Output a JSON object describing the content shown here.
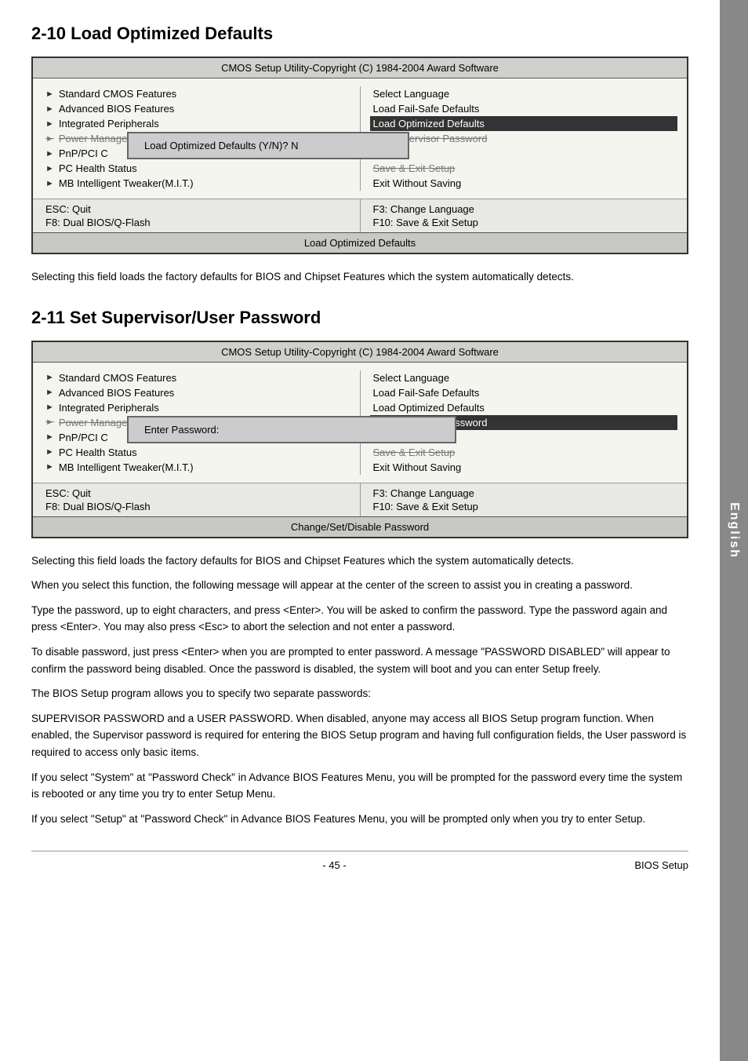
{
  "side_tab": "English",
  "section1": {
    "heading": "2-10    Load Optimized Defaults",
    "bios": {
      "title": "CMOS Setup Utility-Copyright (C) 1984-2004 Award Software",
      "left_items": [
        {
          "arrow": true,
          "label": "Standard CMOS Features",
          "highlighted": false
        },
        {
          "arrow": true,
          "label": "Advanced BIOS Features",
          "highlighted": false
        },
        {
          "arrow": true,
          "label": "Integrated Peripherals",
          "highlighted": false
        },
        {
          "arrow": true,
          "label": "Power Management Setup",
          "highlighted": false,
          "strikethrough": true
        },
        {
          "arrow": true,
          "label": "PnP/PCI C",
          "highlighted": false,
          "dialog": true
        },
        {
          "arrow": true,
          "label": "PC Health Status",
          "highlighted": false,
          "strikethrough": false
        },
        {
          "arrow": true,
          "label": "MB Intelligent Tweaker(M.I.T.)",
          "highlighted": false
        }
      ],
      "right_items": [
        {
          "label": "Select Language",
          "highlighted": false
        },
        {
          "label": "Load Fail-Safe Defaults",
          "highlighted": false
        },
        {
          "label": "Load Optimized Defaults",
          "highlighted": true
        },
        {
          "label": "Set Supervisor Password",
          "highlighted": false,
          "strikethrough": true
        },
        {
          "label": "",
          "highlighted": false
        },
        {
          "label": "Save & Exit Setup",
          "highlighted": false,
          "strikethrough": true
        },
        {
          "label": "Exit Without Saving",
          "highlighted": false
        }
      ],
      "dialog1_text": "Load Optimized Defaults (Y/N)? N",
      "footer": {
        "left": [
          "ESC: Quit",
          "F8: Dual BIOS/Q-Flash"
        ],
        "right": [
          "F3: Change Language",
          "F10: Save & Exit Setup"
        ]
      },
      "status_bar": "Load Optimized Defaults"
    },
    "body_text": "Selecting this field loads the factory defaults for BIOS and Chipset Features which the system automatically detects."
  },
  "section2": {
    "heading": "2-11    Set Supervisor/User Password",
    "bios": {
      "title": "CMOS Setup Utility-Copyright (C) 1984-2004 Award Software",
      "left_items": [
        {
          "arrow": true,
          "label": "Standard CMOS Features",
          "highlighted": false
        },
        {
          "arrow": true,
          "label": "Advanced BIOS Features",
          "highlighted": false
        },
        {
          "arrow": true,
          "label": "Integrated Peripherals",
          "highlighted": false
        },
        {
          "arrow": true,
          "label": "Power Management Setup",
          "highlighted": false,
          "strikethrough": true
        },
        {
          "arrow": true,
          "label": "PnP/PCI C",
          "highlighted": false,
          "dialog": true
        },
        {
          "arrow": true,
          "label": "PC Health Status",
          "highlighted": false,
          "strikethrough": false
        },
        {
          "arrow": true,
          "label": "MB Intelligent Tweaker(M.I.T.)",
          "highlighted": false
        }
      ],
      "right_items": [
        {
          "label": "Select Language",
          "highlighted": false
        },
        {
          "label": "Load Fail-Safe Defaults",
          "highlighted": false
        },
        {
          "label": "Load Optimized Defaults",
          "highlighted": false
        },
        {
          "label": "Set Supervisor Password",
          "highlighted": true,
          "strikethrough": false
        },
        {
          "label": "",
          "highlighted": false
        },
        {
          "label": "Save & Exit Setup",
          "highlighted": false,
          "strikethrough": true
        },
        {
          "label": "Exit Without Saving",
          "highlighted": false
        }
      ],
      "dialog2_text": "Enter Password:",
      "footer": {
        "left": [
          "ESC: Quit",
          "F8: Dual BIOS/Q-Flash"
        ],
        "right": [
          "F3: Change Language",
          "F10: Save & Exit Setup"
        ]
      },
      "status_bar": "Change/Set/Disable Password"
    },
    "body_text1": "Selecting this field loads the factory defaults for BIOS and Chipset Features which the system automatically detects.",
    "body_text2": "When you select this function, the following message will appear at the center of the screen to assist you in creating a password.",
    "body_text3": "Type the password, up to eight characters, and press <Enter>. You will be asked to confirm the password. Type the password again and press <Enter>. You may also press <Esc> to abort the selection and not enter a password.",
    "body_text4": "To disable password, just press <Enter> when you are prompted to enter password. A message \"PASSWORD DISABLED\" will appear to confirm the password being disabled. Once the password is disabled, the system will boot and you can enter Setup freely.",
    "body_text5": "The BIOS Setup program allows you to specify two separate passwords:",
    "body_text6": "SUPERVISOR PASSWORD and a USER PASSWORD. When disabled, anyone may access all BIOS Setup program function. When enabled, the Supervisor password is required for entering the BIOS Setup program and having full configuration fields, the User password is required to access only basic items.",
    "body_text7": "If you select \"System\" at \"Password Check\" in Advance BIOS Features Menu, you will be prompted for the password every time the system is rebooted or any time you try to enter Setup Menu.",
    "body_text8": "If you select \"Setup\" at \"Password Check\" in Advance BIOS Features Menu, you will be prompted only when you try to enter Setup."
  },
  "footer": {
    "page_num": "- 45 -",
    "label": "BIOS Setup"
  }
}
